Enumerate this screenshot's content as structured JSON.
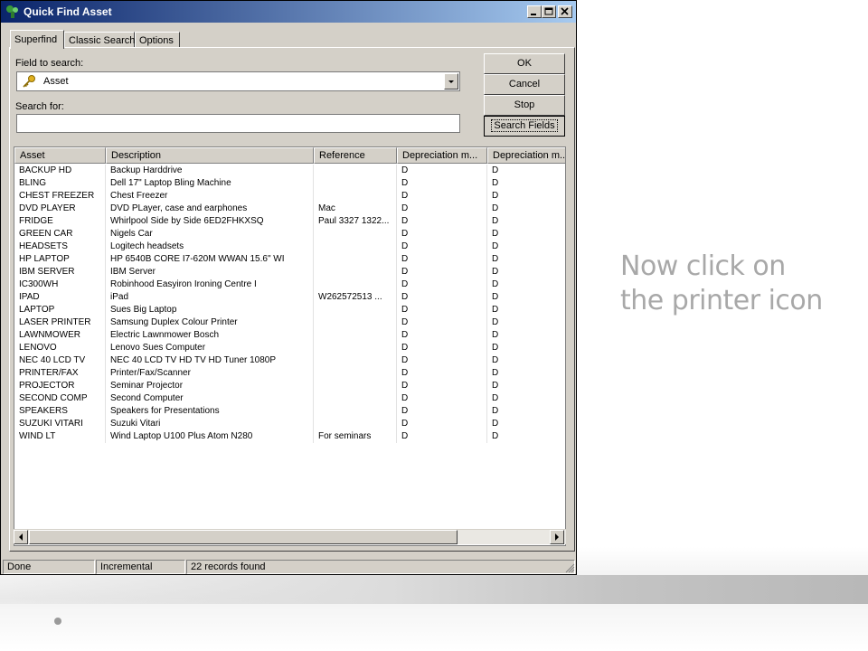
{
  "window": {
    "title": "Quick Find Asset",
    "tabs": [
      "Superfind",
      "Classic Search",
      "Options"
    ],
    "active_tab": "Superfind"
  },
  "search": {
    "field_label": "Field to search:",
    "field_value": "Asset",
    "search_label": "Search for:",
    "search_value": ""
  },
  "buttons": {
    "ok": "OK",
    "cancel": "Cancel",
    "stop": "Stop",
    "search_fields": "Search Fields"
  },
  "grid": {
    "columns": [
      "Asset",
      "Description",
      "Reference",
      "Depreciation m...",
      "Depreciation m..."
    ],
    "rows": [
      [
        "BACKUP HD",
        "Backup Harddrive",
        "",
        "D",
        "D"
      ],
      [
        "BLING",
        "Dell 17\" Laptop Bling Machine",
        "",
        "D",
        "D"
      ],
      [
        "CHEST FREEZER",
        "Chest Freezer",
        "",
        "D",
        "D"
      ],
      [
        "DVD PLAYER",
        "DVD PLayer, case and earphones",
        "Mac",
        "D",
        "D"
      ],
      [
        "FRIDGE",
        "Whirlpool Side by Side 6ED2FHKXSQ",
        "Paul 3327 1322...",
        "D",
        "D"
      ],
      [
        "GREEN CAR",
        "Nigels Car",
        "",
        "D",
        "D"
      ],
      [
        "HEADSETS",
        "Logitech headsets",
        "",
        "D",
        "D"
      ],
      [
        "HP LAPTOP",
        "HP 6540B CORE I7-620M WWAN 15.6\" WI",
        "",
        "D",
        "D"
      ],
      [
        "IBM SERVER",
        "IBM Server",
        "",
        "D",
        "D"
      ],
      [
        "IC300WH",
        "Robinhood Easyiron Ironing Centre I",
        "",
        "D",
        "D"
      ],
      [
        "IPAD",
        "iPad",
        "W262572513  ...",
        "D",
        "D"
      ],
      [
        "LAPTOP",
        "Sues Big Laptop",
        "",
        "D",
        "D"
      ],
      [
        "LASER PRINTER",
        "Samsung Duplex Colour Printer",
        "",
        "D",
        "D"
      ],
      [
        "LAWNMOWER",
        "Electric Lawnmower Bosch",
        "",
        "D",
        "D"
      ],
      [
        "LENOVO",
        "Lenovo Sues Computer",
        "",
        "D",
        "D"
      ],
      [
        "NEC 40 LCD TV",
        "NEC 40 LCD TV HD TV HD Tuner 1080P",
        "",
        "D",
        "D"
      ],
      [
        "PRINTER/FAX",
        "Printer/Fax/Scanner",
        "",
        "D",
        "D"
      ],
      [
        "PROJECTOR",
        "Seminar Projector",
        "",
        "D",
        "D"
      ],
      [
        "SECOND COMP",
        "Second Computer",
        "",
        "D",
        "D"
      ],
      [
        "SPEAKERS",
        "Speakers for Presentations",
        "",
        "D",
        "D"
      ],
      [
        "SUZUKI VITARI",
        "Suzuki Vitari",
        "",
        "D",
        "D"
      ],
      [
        "WIND LT",
        "Wind Laptop U100 Plus Atom N280",
        "For seminars",
        "D",
        "D"
      ]
    ]
  },
  "status": {
    "state": "Done",
    "mode": "Incremental",
    "records": "22 records found"
  },
  "caption": {
    "line1": "Now click on",
    "line2": "the printer icon"
  },
  "colors": {
    "titlebar_start": "#0a246a",
    "titlebar_end": "#a6caf0",
    "window_face": "#d4d0c8",
    "caption": "#a8a8a8"
  },
  "icons": [
    "app-icon",
    "minimize-icon",
    "maximize-icon",
    "close-icon",
    "key-icon",
    "dropdown-arrow-icon",
    "printer-icon",
    "scroll-left-icon",
    "scroll-right-icon",
    "size-grip-icon"
  ]
}
